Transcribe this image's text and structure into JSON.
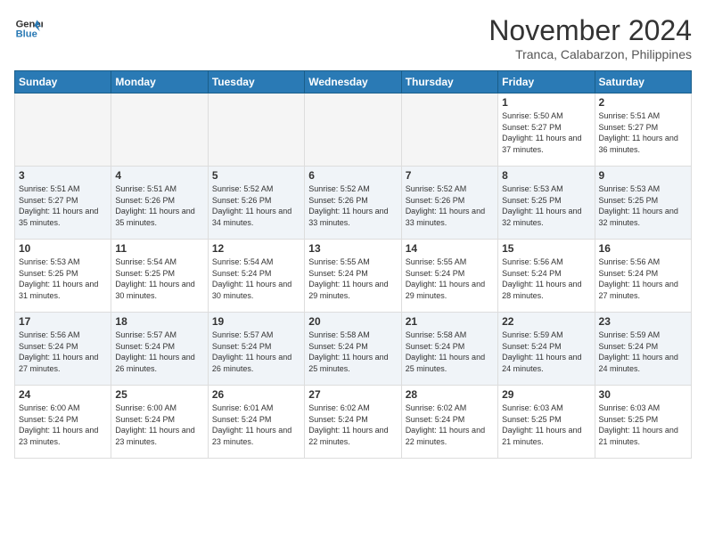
{
  "header": {
    "logo_line1": "General",
    "logo_line2": "Blue",
    "month": "November 2024",
    "location": "Tranca, Calabarzon, Philippines"
  },
  "weekdays": [
    "Sunday",
    "Monday",
    "Tuesday",
    "Wednesday",
    "Thursday",
    "Friday",
    "Saturday"
  ],
  "weeks": [
    [
      {
        "day": "",
        "sunrise": "",
        "sunset": "",
        "daylight": "",
        "empty": true
      },
      {
        "day": "",
        "sunrise": "",
        "sunset": "",
        "daylight": "",
        "empty": true
      },
      {
        "day": "",
        "sunrise": "",
        "sunset": "",
        "daylight": "",
        "empty": true
      },
      {
        "day": "",
        "sunrise": "",
        "sunset": "",
        "daylight": "",
        "empty": true
      },
      {
        "day": "",
        "sunrise": "",
        "sunset": "",
        "daylight": "",
        "empty": true
      },
      {
        "day": "1",
        "sunrise": "Sunrise: 5:50 AM",
        "sunset": "Sunset: 5:27 PM",
        "daylight": "Daylight: 11 hours and 37 minutes.",
        "empty": false
      },
      {
        "day": "2",
        "sunrise": "Sunrise: 5:51 AM",
        "sunset": "Sunset: 5:27 PM",
        "daylight": "Daylight: 11 hours and 36 minutes.",
        "empty": false
      }
    ],
    [
      {
        "day": "3",
        "sunrise": "Sunrise: 5:51 AM",
        "sunset": "Sunset: 5:27 PM",
        "daylight": "Daylight: 11 hours and 35 minutes.",
        "empty": false
      },
      {
        "day": "4",
        "sunrise": "Sunrise: 5:51 AM",
        "sunset": "Sunset: 5:26 PM",
        "daylight": "Daylight: 11 hours and 35 minutes.",
        "empty": false
      },
      {
        "day": "5",
        "sunrise": "Sunrise: 5:52 AM",
        "sunset": "Sunset: 5:26 PM",
        "daylight": "Daylight: 11 hours and 34 minutes.",
        "empty": false
      },
      {
        "day": "6",
        "sunrise": "Sunrise: 5:52 AM",
        "sunset": "Sunset: 5:26 PM",
        "daylight": "Daylight: 11 hours and 33 minutes.",
        "empty": false
      },
      {
        "day": "7",
        "sunrise": "Sunrise: 5:52 AM",
        "sunset": "Sunset: 5:26 PM",
        "daylight": "Daylight: 11 hours and 33 minutes.",
        "empty": false
      },
      {
        "day": "8",
        "sunrise": "Sunrise: 5:53 AM",
        "sunset": "Sunset: 5:25 PM",
        "daylight": "Daylight: 11 hours and 32 minutes.",
        "empty": false
      },
      {
        "day": "9",
        "sunrise": "Sunrise: 5:53 AM",
        "sunset": "Sunset: 5:25 PM",
        "daylight": "Daylight: 11 hours and 32 minutes.",
        "empty": false
      }
    ],
    [
      {
        "day": "10",
        "sunrise": "Sunrise: 5:53 AM",
        "sunset": "Sunset: 5:25 PM",
        "daylight": "Daylight: 11 hours and 31 minutes.",
        "empty": false
      },
      {
        "day": "11",
        "sunrise": "Sunrise: 5:54 AM",
        "sunset": "Sunset: 5:25 PM",
        "daylight": "Daylight: 11 hours and 30 minutes.",
        "empty": false
      },
      {
        "day": "12",
        "sunrise": "Sunrise: 5:54 AM",
        "sunset": "Sunset: 5:24 PM",
        "daylight": "Daylight: 11 hours and 30 minutes.",
        "empty": false
      },
      {
        "day": "13",
        "sunrise": "Sunrise: 5:55 AM",
        "sunset": "Sunset: 5:24 PM",
        "daylight": "Daylight: 11 hours and 29 minutes.",
        "empty": false
      },
      {
        "day": "14",
        "sunrise": "Sunrise: 5:55 AM",
        "sunset": "Sunset: 5:24 PM",
        "daylight": "Daylight: 11 hours and 29 minutes.",
        "empty": false
      },
      {
        "day": "15",
        "sunrise": "Sunrise: 5:56 AM",
        "sunset": "Sunset: 5:24 PM",
        "daylight": "Daylight: 11 hours and 28 minutes.",
        "empty": false
      },
      {
        "day": "16",
        "sunrise": "Sunrise: 5:56 AM",
        "sunset": "Sunset: 5:24 PM",
        "daylight": "Daylight: 11 hours and 27 minutes.",
        "empty": false
      }
    ],
    [
      {
        "day": "17",
        "sunrise": "Sunrise: 5:56 AM",
        "sunset": "Sunset: 5:24 PM",
        "daylight": "Daylight: 11 hours and 27 minutes.",
        "empty": false
      },
      {
        "day": "18",
        "sunrise": "Sunrise: 5:57 AM",
        "sunset": "Sunset: 5:24 PM",
        "daylight": "Daylight: 11 hours and 26 minutes.",
        "empty": false
      },
      {
        "day": "19",
        "sunrise": "Sunrise: 5:57 AM",
        "sunset": "Sunset: 5:24 PM",
        "daylight": "Daylight: 11 hours and 26 minutes.",
        "empty": false
      },
      {
        "day": "20",
        "sunrise": "Sunrise: 5:58 AM",
        "sunset": "Sunset: 5:24 PM",
        "daylight": "Daylight: 11 hours and 25 minutes.",
        "empty": false
      },
      {
        "day": "21",
        "sunrise": "Sunrise: 5:58 AM",
        "sunset": "Sunset: 5:24 PM",
        "daylight": "Daylight: 11 hours and 25 minutes.",
        "empty": false
      },
      {
        "day": "22",
        "sunrise": "Sunrise: 5:59 AM",
        "sunset": "Sunset: 5:24 PM",
        "daylight": "Daylight: 11 hours and 24 minutes.",
        "empty": false
      },
      {
        "day": "23",
        "sunrise": "Sunrise: 5:59 AM",
        "sunset": "Sunset: 5:24 PM",
        "daylight": "Daylight: 11 hours and 24 minutes.",
        "empty": false
      }
    ],
    [
      {
        "day": "24",
        "sunrise": "Sunrise: 6:00 AM",
        "sunset": "Sunset: 5:24 PM",
        "daylight": "Daylight: 11 hours and 23 minutes.",
        "empty": false
      },
      {
        "day": "25",
        "sunrise": "Sunrise: 6:00 AM",
        "sunset": "Sunset: 5:24 PM",
        "daylight": "Daylight: 11 hours and 23 minutes.",
        "empty": false
      },
      {
        "day": "26",
        "sunrise": "Sunrise: 6:01 AM",
        "sunset": "Sunset: 5:24 PM",
        "daylight": "Daylight: 11 hours and 23 minutes.",
        "empty": false
      },
      {
        "day": "27",
        "sunrise": "Sunrise: 6:02 AM",
        "sunset": "Sunset: 5:24 PM",
        "daylight": "Daylight: 11 hours and 22 minutes.",
        "empty": false
      },
      {
        "day": "28",
        "sunrise": "Sunrise: 6:02 AM",
        "sunset": "Sunset: 5:24 PM",
        "daylight": "Daylight: 11 hours and 22 minutes.",
        "empty": false
      },
      {
        "day": "29",
        "sunrise": "Sunrise: 6:03 AM",
        "sunset": "Sunset: 5:25 PM",
        "daylight": "Daylight: 11 hours and 21 minutes.",
        "empty": false
      },
      {
        "day": "30",
        "sunrise": "Sunrise: 6:03 AM",
        "sunset": "Sunset: 5:25 PM",
        "daylight": "Daylight: 11 hours and 21 minutes.",
        "empty": false
      }
    ]
  ]
}
